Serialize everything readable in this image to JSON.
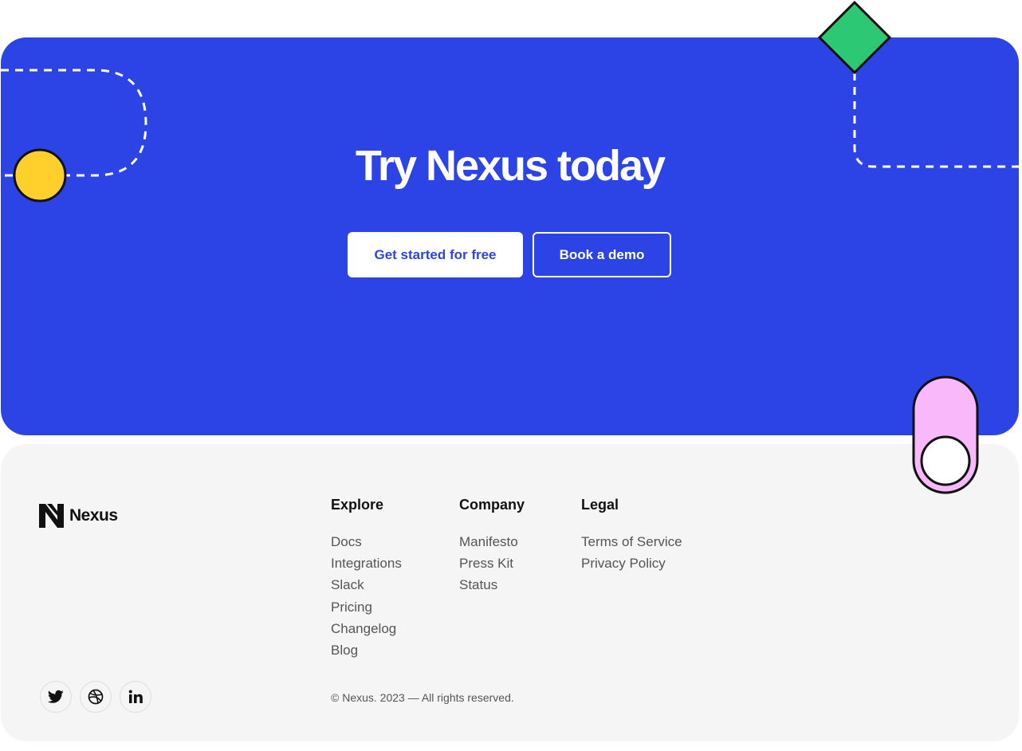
{
  "cta": {
    "title": "Try Nexus today",
    "primary_button": "Get started for free",
    "secondary_button": "Book a demo"
  },
  "colors": {
    "brand_blue": "#2c44e6",
    "yellow_dot": "#ffd02b",
    "green_diamond": "#2cc874",
    "pink_toggle": "#f9b8f9",
    "footer_bg": "#f5f5f5"
  },
  "footer": {
    "brand_name": "Nexus",
    "columns": [
      {
        "heading": "Explore",
        "links": [
          "Docs",
          "Integrations",
          "Slack",
          "Pricing",
          "Changelog",
          "Blog"
        ]
      },
      {
        "heading": "Company",
        "links": [
          "Manifesto",
          "Press Kit",
          "Status"
        ]
      },
      {
        "heading": "Legal",
        "links": [
          "Terms of Service",
          "Privacy Policy"
        ]
      }
    ],
    "social_icons": [
      "twitter-icon",
      "dribbble-icon",
      "linkedin-icon"
    ],
    "copyright": "© Nexus. 2023 — All rights reserved."
  }
}
